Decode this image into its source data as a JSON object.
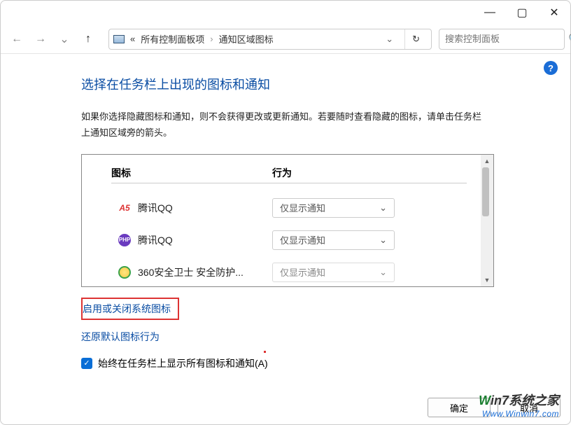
{
  "titlebar": {
    "minimize": "—",
    "maximize": "▢",
    "close": "✕"
  },
  "nav": {
    "back": "←",
    "forward": "→",
    "recent": "⌄",
    "up": "↑"
  },
  "breadcrumb": {
    "icon": "monitor",
    "chevrons": "«",
    "item1": "所有控制面板项",
    "sep": "›",
    "item2": "通知区域图标",
    "dropdown": "⌄",
    "refresh": "↻"
  },
  "search": {
    "placeholder": "搜索控制面板",
    "icon": "🔍"
  },
  "help": "?",
  "heading": "选择在任务栏上出现的图标和通知",
  "description": "如果你选择隐藏图标和通知，则不会获得更改或更新通知。若要随时查看隐藏的图标，请单击任务栏上通知区域旁的箭头。",
  "table": {
    "col_icon": "图标",
    "col_behavior": "行为",
    "rows": [
      {
        "icon": "a5",
        "name": "腾讯QQ",
        "behavior": "仅显示通知"
      },
      {
        "icon": "php",
        "name": "腾讯QQ",
        "behavior": "仅显示通知"
      },
      {
        "icon": "360",
        "name": "360安全卫士 安全防护...",
        "behavior": "仅显示通知"
      }
    ],
    "dropdown_chevron": "⌄"
  },
  "links": {
    "system_icons": "启用或关闭系统图标",
    "restore_defaults": "还原默认图标行为",
    "always_show": "始终在任务栏上显示所有图标和通知(A)"
  },
  "footer": {
    "ok": "确定",
    "cancel": "取消"
  },
  "watermark": {
    "line1_w": "W",
    "line1_rest": "in7系统之家",
    "line2": "Www.Winwin7.com"
  }
}
